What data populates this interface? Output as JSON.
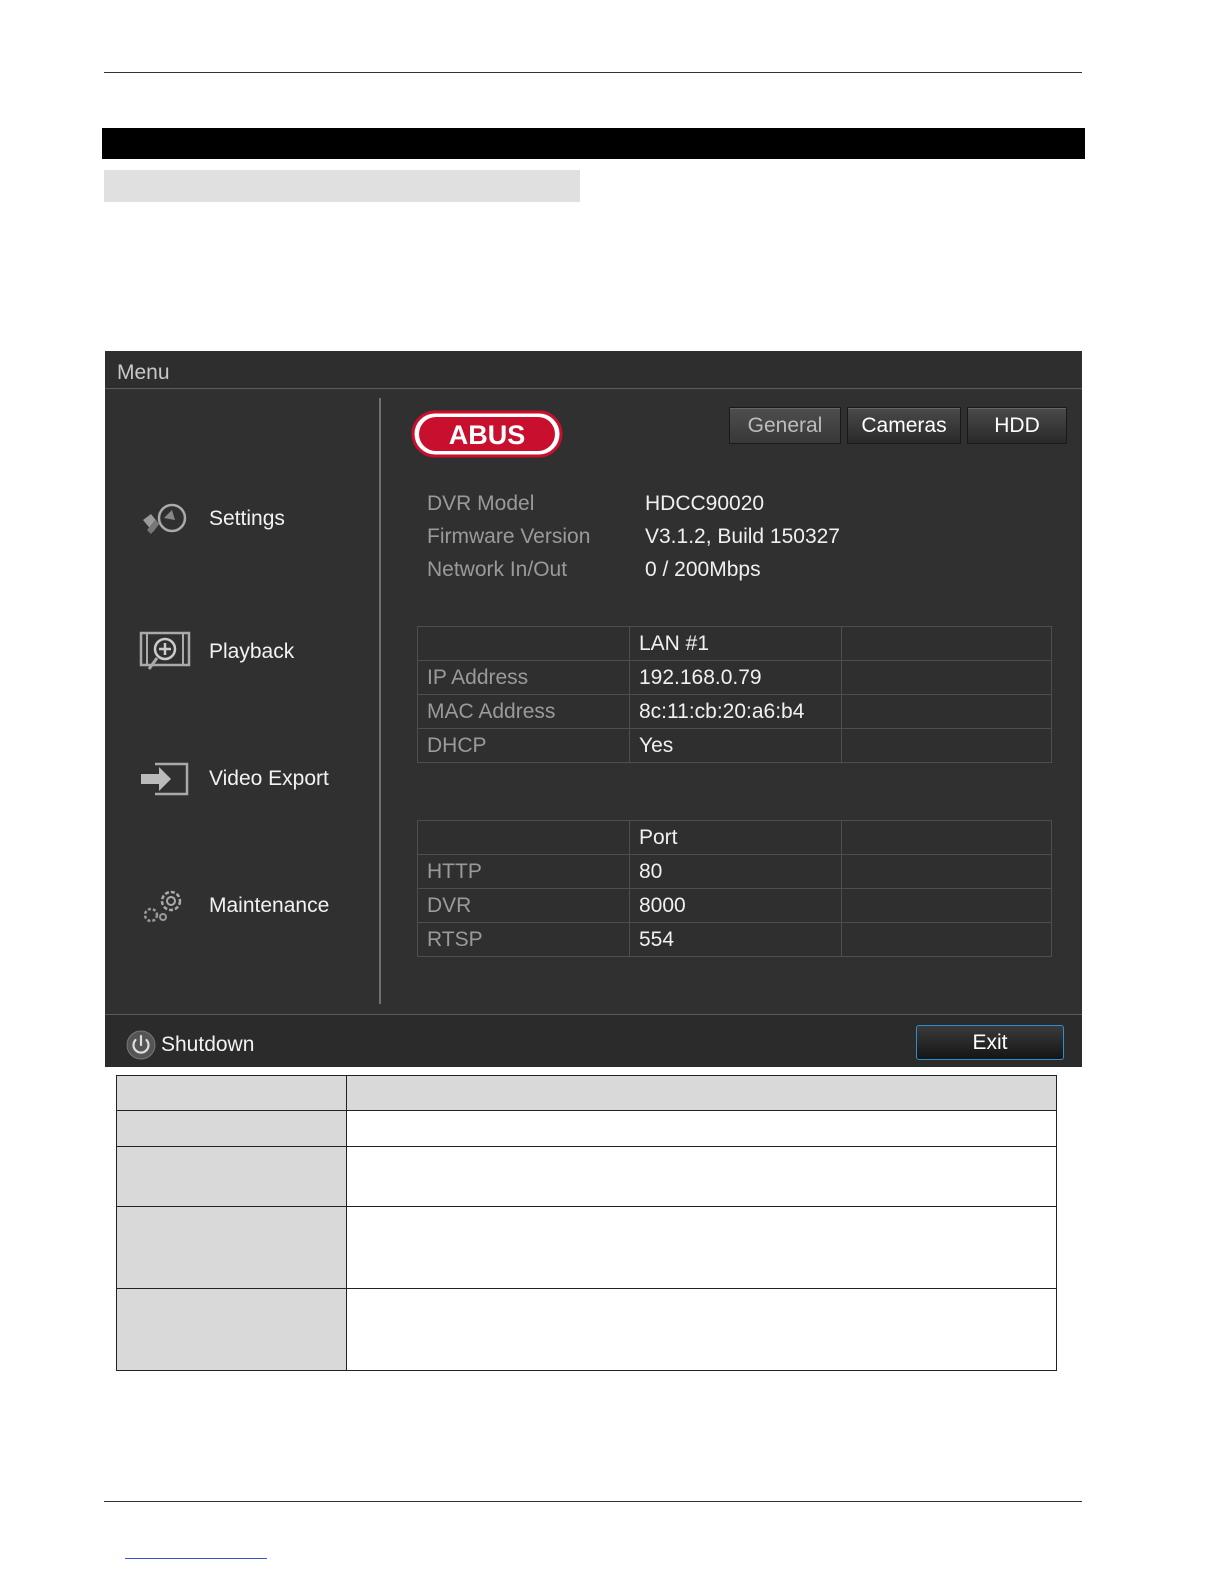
{
  "window": {
    "title": "Menu"
  },
  "sidebar": {
    "items": [
      {
        "label": "Settings",
        "icon": "settings-icon"
      },
      {
        "label": "Playback",
        "icon": "playback-icon"
      },
      {
        "label": "Video Export",
        "icon": "video-export-icon"
      },
      {
        "label": "Maintenance",
        "icon": "maintenance-icon"
      }
    ]
  },
  "logo": {
    "text": "ABUS",
    "color": "#c8102e"
  },
  "tabs": [
    {
      "label": "General",
      "selected": true
    },
    {
      "label": "Cameras",
      "selected": false
    },
    {
      "label": "HDD",
      "selected": false
    }
  ],
  "device_info": [
    {
      "label": "DVR Model",
      "value": "HDCC90020"
    },
    {
      "label": "Firmware Version",
      "value": "V3.1.2, Build 150327"
    },
    {
      "label": "Network In/Out",
      "value": "0 / 200Mbps"
    }
  ],
  "network_table": {
    "header": [
      "",
      "LAN #1",
      ""
    ],
    "rows": [
      [
        "IP Address",
        "192.168.0.79",
        ""
      ],
      [
        "MAC Address",
        "8c:11:cb:20:a6:b4",
        ""
      ],
      [
        "DHCP",
        "Yes",
        ""
      ]
    ]
  },
  "port_table": {
    "header": [
      "",
      "Port",
      ""
    ],
    "rows": [
      [
        "HTTP",
        "80",
        ""
      ],
      [
        "DVR",
        "8000",
        ""
      ],
      [
        "RTSP",
        "554",
        ""
      ]
    ]
  },
  "footer": {
    "shutdown_label": "Shutdown",
    "exit_label": "Exit",
    "exit_border_color": "#2a8fd0"
  }
}
